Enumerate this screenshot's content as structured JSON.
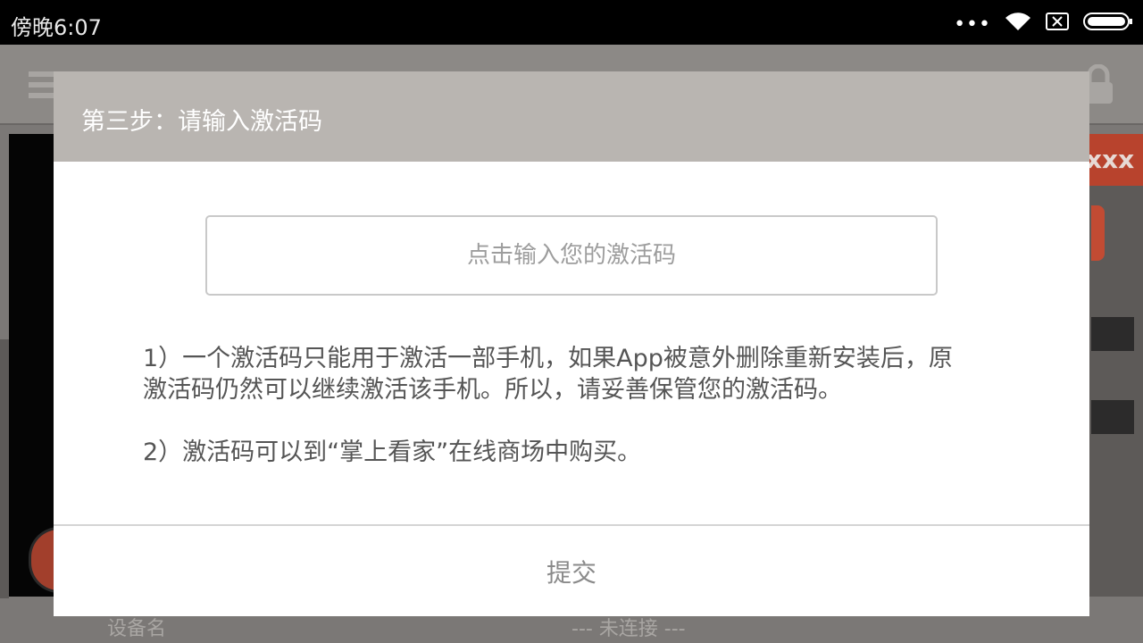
{
  "status_bar": {
    "time": "傍晚6:07",
    "icons": [
      "more-dots-icon",
      "wifi-icon",
      "no-sim-icon",
      "battery-icon"
    ]
  },
  "background_app": {
    "partial_label_right": "xxx",
    "device_name_label": "设备名",
    "connection_status": "--- 未连接 ---"
  },
  "dialog": {
    "title": "第三步：请输入激活码",
    "input_placeholder": "点击输入您的激活码",
    "input_value": "",
    "notes": [
      "1）一个激活码只能用于激活一部手机，如果App被意外删除重新安装后，原激活码仍然可以继续激活该手机。所以，请妥善保管您的激活码。",
      "2）激活码可以到“掌上看家”在线商场中购买。"
    ],
    "submit_label": "提交"
  },
  "colors": {
    "dialog_header": "#b9b5b1",
    "accent_orange": "#c24b33",
    "status_bar": "#000000"
  }
}
